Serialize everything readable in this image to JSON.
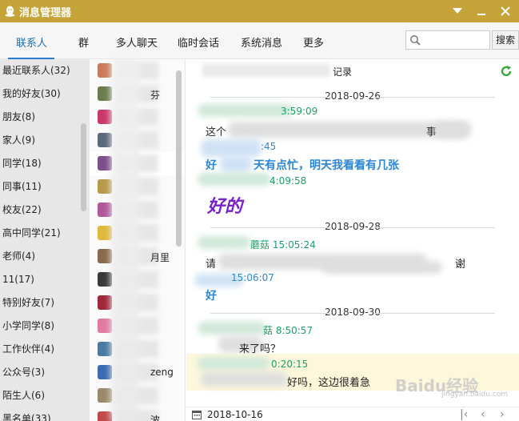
{
  "window": {
    "title": "消息管理器",
    "accent_color": "#c6a43a"
  },
  "tabs": [
    {
      "label": "联系人",
      "active": true
    },
    {
      "label": "群"
    },
    {
      "label": "多人聊天"
    },
    {
      "label": "临时会话"
    },
    {
      "label": "系统消息"
    },
    {
      "label": "更多"
    }
  ],
  "search": {
    "placeholder": "",
    "button_label": "搜索"
  },
  "groups": [
    "最近联系人(32)",
    "我的好友(30)",
    "朋友(8)",
    "家人(9)",
    "同学(18)",
    "同事(11)",
    "校友(22)",
    "高中同学(21)",
    "老师(4)",
    "11(17)",
    "特别好友(7)",
    "小学同学(8)",
    "工作伙伴(4)",
    "公众号(3)",
    "陌生人(6)",
    "黑名单(33)"
  ],
  "contacts": [
    {
      "name": "",
      "avatar_color": "#c97b5a"
    },
    {
      "name": "芬",
      "avatar_color": "#6a7c4e"
    },
    {
      "name": "",
      "avatar_color": "#c93a6a"
    },
    {
      "name": "",
      "avatar_color": "#5a6a7a"
    },
    {
      "name": "",
      "avatar_color": "#7b4f8a"
    },
    {
      "name": "",
      "avatar_color": "#b89a4a"
    },
    {
      "name": "",
      "avatar_color": "#b0579c"
    },
    {
      "name": "",
      "avatar_color": "#e0b83c"
    },
    {
      "name": "月里",
      "avatar_color": "#8a6a4a"
    },
    {
      "name": "",
      "avatar_color": "#3a3a3a"
    },
    {
      "name": "",
      "avatar_color": "#a0283a"
    },
    {
      "name": "",
      "avatar_color": "#e07aa0"
    },
    {
      "name": "",
      "avatar_color": "#4a7aa0"
    },
    {
      "name": "zeng",
      "avatar_color": "#3a6ab0"
    },
    {
      "name": "",
      "avatar_color": "#9a8a6a"
    },
    {
      "name": "波",
      "avatar_color": "#c04a4a"
    }
  ],
  "chat": {
    "header_suffix": "记录",
    "days": [
      {
        "date": "2018-09-26",
        "messages": [
          {
            "meta": "3:59:09",
            "text": "这个",
            "tail": "事"
          },
          {
            "meta": ":45",
            "text": "好",
            "bold_text": "天有点忙，明天我看看有几张"
          },
          {
            "meta": "4:09:58",
            "text": "好的"
          }
        ]
      },
      {
        "date": "2018-09-28",
        "messages": [
          {
            "meta": "蘑菇 15:05:24",
            "text": "请",
            "tail": "谢"
          },
          {
            "meta": "15:06:07",
            "text": "好"
          }
        ]
      },
      {
        "date": "2018-09-30",
        "messages": [
          {
            "meta": "菇 8:50:57",
            "text": "来了吗？"
          },
          {
            "meta": "0:20:15",
            "text": "好吗，这边很着急"
          }
        ]
      }
    ]
  },
  "footer": {
    "date": "2018-10-16"
  },
  "watermark": {
    "main": "Baidu经验",
    "sub": "jingyan.baidu.com"
  }
}
